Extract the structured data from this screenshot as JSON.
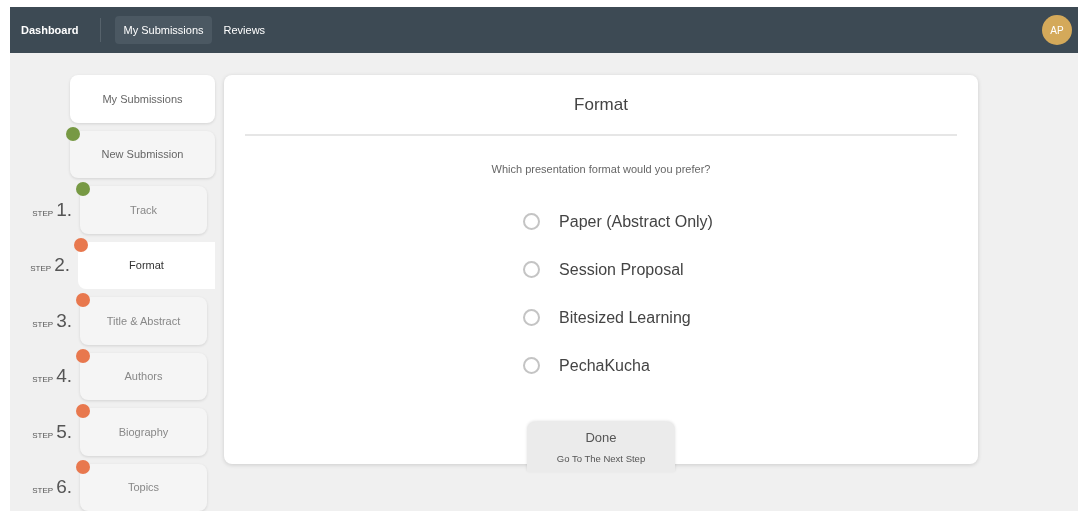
{
  "nav": {
    "brand": "Dashboard",
    "links": [
      {
        "label": "My Submissions",
        "selected": true
      },
      {
        "label": "Reviews",
        "selected": false
      }
    ],
    "avatar": "AP"
  },
  "sidebar": {
    "items": [
      {
        "label": "My Submissions",
        "kind": "link"
      },
      {
        "label": "New Submission",
        "kind": "section",
        "color": "#779944"
      }
    ],
    "steps": [
      {
        "step": "STEP",
        "number": "1.",
        "label": "Track",
        "selected": false,
        "color": "#779944"
      },
      {
        "step": "STEP",
        "number": "2.",
        "label": "Format",
        "selected": true,
        "color": "#e8784e"
      },
      {
        "step": "STEP",
        "number": "3.",
        "label": "Title & Abstract",
        "selected": false,
        "color": "#e8784e"
      },
      {
        "step": "STEP",
        "number": "4.",
        "label": "Authors",
        "selected": false,
        "color": "#e8784e"
      },
      {
        "step": "STEP",
        "number": "5.",
        "label": "Biography",
        "selected": false,
        "color": "#e8784e"
      },
      {
        "step": "STEP",
        "number": "6.",
        "label": "Topics",
        "selected": false,
        "color": "#e8784e"
      }
    ]
  },
  "panel": {
    "title": "Format",
    "question": "Which presentation format would you prefer?",
    "options": [
      {
        "label": "Paper (Abstract Only)",
        "selected": false
      },
      {
        "label": "Session Proposal",
        "selected": false
      },
      {
        "label": "Bitesized Learning",
        "selected": false
      },
      {
        "label": "PechaKucha",
        "selected": false
      }
    ],
    "done": {
      "label": "Done",
      "sublabel": "Go To The Next Step"
    }
  }
}
